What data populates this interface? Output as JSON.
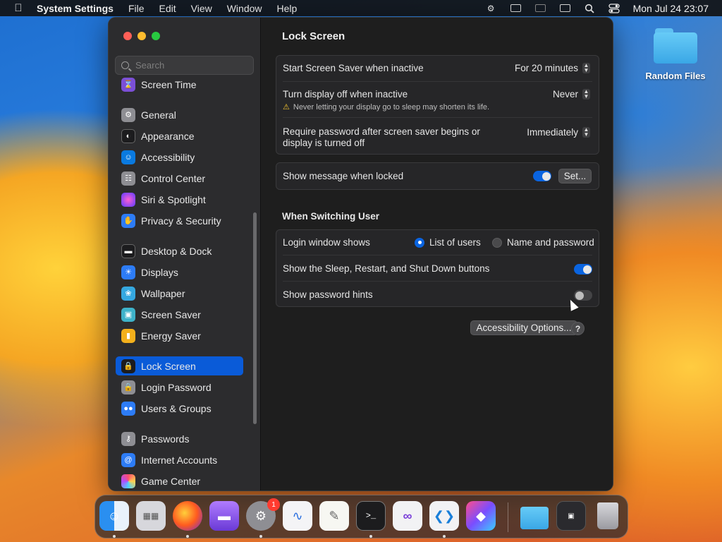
{
  "menubar": {
    "app_name": "System Settings",
    "menus": [
      "File",
      "Edit",
      "View",
      "Window",
      "Help"
    ],
    "clock": "Mon Jul 24  23:07"
  },
  "desktop": {
    "folder_label": "Random Files"
  },
  "sidebar": {
    "search_placeholder": "Search",
    "items": [
      {
        "label": "Screen Time",
        "icon": "hourglass-icon",
        "color": "#7b4fd6"
      },
      {
        "label": "General",
        "icon": "gear-icon",
        "color": "#8e8e93"
      },
      {
        "label": "Appearance",
        "icon": "appearance-icon",
        "color": "#1c1c1e"
      },
      {
        "label": "Accessibility",
        "icon": "accessibility-icon",
        "color": "#0a7ae0"
      },
      {
        "label": "Control Center",
        "icon": "control-center-icon",
        "color": "#8e8e93"
      },
      {
        "label": "Siri & Spotlight",
        "icon": "siri-icon",
        "color": "#c33cc9"
      },
      {
        "label": "Privacy & Security",
        "icon": "hand-icon",
        "color": "#2d7cf6"
      },
      {
        "label": "Desktop & Dock",
        "icon": "dock-icon",
        "color": "#1c1c1e"
      },
      {
        "label": "Displays",
        "icon": "sun-icon",
        "color": "#2d7cf6"
      },
      {
        "label": "Wallpaper",
        "icon": "flower-icon",
        "color": "#35a8e0"
      },
      {
        "label": "Screen Saver",
        "icon": "screen-saver-icon",
        "color": "#3eb2c9"
      },
      {
        "label": "Energy Saver",
        "icon": "battery-icon",
        "color": "#f3b01c"
      },
      {
        "label": "Lock Screen",
        "icon": "lock-icon",
        "color": "#1c1c1e"
      },
      {
        "label": "Login Password",
        "icon": "lock-icon",
        "color": "#8e8e93"
      },
      {
        "label": "Users & Groups",
        "icon": "users-icon",
        "color": "#2d7cf6"
      },
      {
        "label": "Passwords",
        "icon": "key-icon",
        "color": "#8e8e93"
      },
      {
        "label": "Internet Accounts",
        "icon": "at-icon",
        "color": "#2d7cf6"
      },
      {
        "label": "Game Center",
        "icon": "game-center-icon",
        "color": "#e0e0e0"
      }
    ],
    "selected": "Lock Screen"
  },
  "main": {
    "title": "Lock Screen",
    "screen_saver": {
      "label": "Start Screen Saver when inactive",
      "value": "For 20 minutes"
    },
    "display_off": {
      "label": "Turn display off when inactive",
      "value": "Never",
      "warning": "Never letting your display go to sleep may shorten its life."
    },
    "require_password": {
      "label_line1": "Require password after screen saver begins or",
      "label_line2": "display is turned off",
      "value": "Immediately"
    },
    "show_message": {
      "label": "Show message when locked",
      "enabled": true,
      "button": "Set..."
    },
    "switching_title": "When Switching User",
    "login_window": {
      "label": "Login window shows",
      "option1": "List of users",
      "option2": "Name and password",
      "selected": "List of users"
    },
    "sleep_buttons": {
      "label": "Show the Sleep, Restart, and Shut Down buttons",
      "enabled": true
    },
    "password_hints": {
      "label": "Show password hints",
      "enabled": false
    },
    "accessibility_button": "Accessibility Options...",
    "help_button": "?"
  },
  "dock": {
    "settings_badge": "1",
    "apps": [
      "finder-icon",
      "launchpad-icon",
      "firefox-icon",
      "podcasts-icon",
      "system-settings-icon",
      "freeform-icon",
      "textedit-icon",
      "terminal-icon",
      "visual-studio-icon",
      "vscode-icon",
      "shortcuts-icon",
      "downloads-folder-icon",
      "screen-sharing-icon",
      "trash-icon"
    ]
  }
}
